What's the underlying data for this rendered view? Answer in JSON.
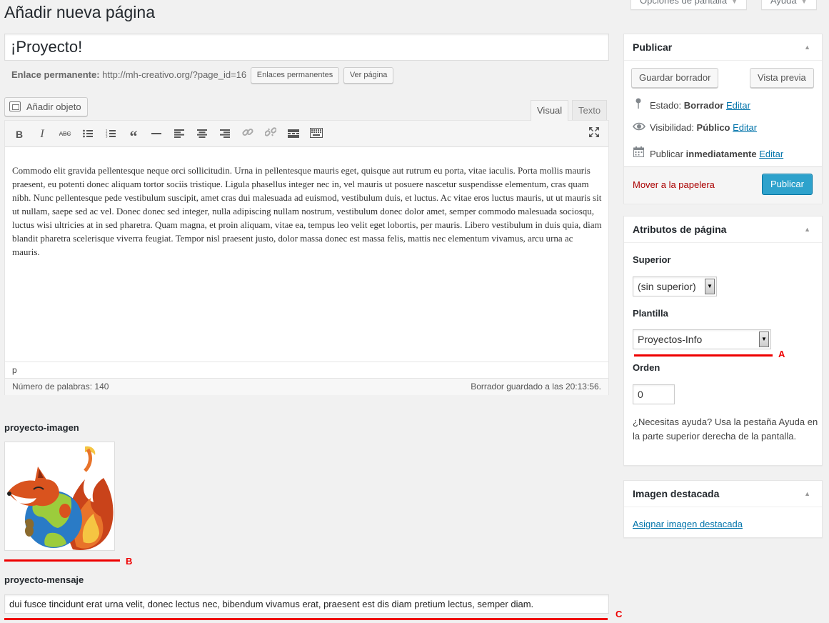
{
  "header": {
    "title": "Añadir nueva página",
    "screen_options": "Opciones de pantalla",
    "help": "Ayuda"
  },
  "post": {
    "title_value": "¡Proyecto!",
    "permalink_label": "Enlace permanente:",
    "permalink_url": "http://mh-creativo.org/?page_id=16",
    "permalinks_button": "Enlaces permanentes",
    "view_page_button": "Ver página"
  },
  "editor": {
    "add_media": "Añadir objeto",
    "tabs": {
      "visual": "Visual",
      "text": "Texto"
    },
    "content": "Commodo elit gravida pellentesque neque orci sollicitudin. Urna in pellentesque mauris eget, quisque aut rutrum eu porta, vitae iaculis. Porta mollis mauris praesent, eu potenti donec aliquam tortor sociis tristique. Ligula phasellus integer nec in, vel mauris ut posuere nascetur suspendisse elementum, cras quam nibh. Nunc pellentesque pede vestibulum suscipit, amet cras dui malesuada ad euismod, vestibulum duis, et luctus. Ac vitae eros luctus mauris, ut ut mauris sit ut nullam, saepe sed ac vel. Donec donec sed integer, nulla adipiscing nullam nostrum, vestibulum donec dolor amet, semper commodo malesuada sociosqu, luctus wisi ultricies at in sed pharetra. Quam magna, et proin aliquam, vitae ea, tempus leo velit eget lobortis, per mauris. Libero vestibulum in duis quia, diam blandit pharetra scelerisque viverra feugiat. Tempor nisl praesent justo, dolor massa donec est massa felis, mattis nec elementum vivamus, arcu urna ac mauris.",
    "path": "p",
    "word_count": "Número de palabras: 140",
    "draft_saved": "Borrador guardado a las 20:13:56."
  },
  "custom_fields": {
    "image_label": "proyecto-imagen",
    "message_label": "proyecto-mensaje",
    "message_value": "dui fusce tincidunt erat urna velit, donec lectus nec, bibendum vivamus erat, praesent est dis diam pretium lectus, semper diam."
  },
  "annotations": {
    "a": "A",
    "b": "B",
    "c": "C",
    "color": "#e00000"
  },
  "publish_box": {
    "title": "Publicar",
    "save_draft": "Guardar borrador",
    "preview": "Vista previa",
    "status_label": "Estado:",
    "status_value": "Borrador",
    "visibility_label": "Visibilidad:",
    "visibility_value": "Público",
    "publish_label": "Publicar",
    "publish_value": "inmediatamente",
    "edit": "Editar",
    "trash": "Mover a la papelera",
    "publish_button": "Publicar"
  },
  "page_attributes": {
    "title": "Atributos de página",
    "parent_label": "Superior",
    "parent_value": "(sin superior)",
    "template_label": "Plantilla",
    "template_value": "Proyectos-Info",
    "order_label": "Orden",
    "order_value": "0",
    "help_text": "¿Necesitas ayuda? Usa la pestaña Ayuda en la parte superior derecha de la pantalla."
  },
  "featured_image": {
    "title": "Imagen destacada",
    "set_link": "Asignar imagen destacada"
  },
  "colors": {
    "primary": "#2ea2cc",
    "link": "#0073aa",
    "danger": "#aa0000"
  }
}
